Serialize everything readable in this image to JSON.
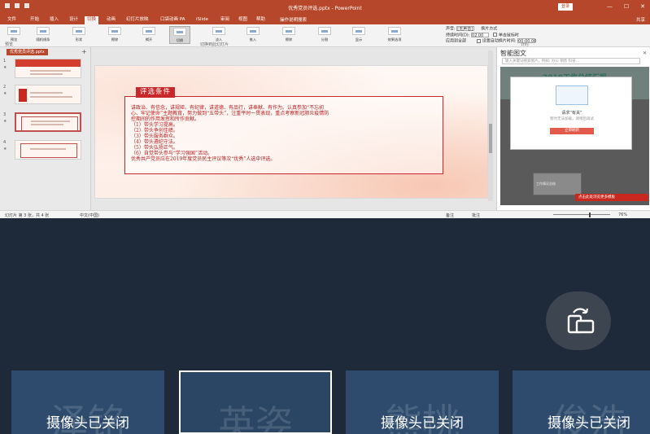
{
  "ppt": {
    "title": "优秀党员评选.pptx - PowerPoint",
    "account": "登录",
    "tabs": [
      "文件",
      "开始",
      "插入",
      "设计",
      "切换",
      "动画",
      "幻灯片放映",
      "口袋动画 PA",
      "iSlide",
      "审阅",
      "视图",
      "帮助",
      "PDF"
    ],
    "active_tab_index": 4,
    "tell_me": "操作说明搜索",
    "share": "共享",
    "ribbon_buttons": [
      "预览",
      "随机线条",
      "形状",
      "擦除",
      "揭开",
      "切换",
      "淡入",
      "推入",
      "擦除",
      "分割",
      "显示",
      "效果选项"
    ],
    "selected_ribbon_index": 4,
    "group_left": "预览",
    "group_mid": "切换到此幻灯片",
    "group_right": "计时",
    "timing": {
      "sound_label": "声音:",
      "sound_value": "[无声音]",
      "duration_label": "持续时间(D):",
      "duration_value": "02.00",
      "apply_all": "应用到全部",
      "advance_label": "换片方式",
      "on_click": "单击鼠标时",
      "after_label": "设置自动换片时间:",
      "after_value": "00:00.00"
    },
    "doc_chip": "优秀党员评选.pptx",
    "thumbs": [
      {
        "num": "1"
      },
      {
        "num": "2"
      },
      {
        "num": "3"
      },
      {
        "num": "4"
      }
    ],
    "selected_thumb_index": 2,
    "slide": {
      "tag": "评选条件",
      "lines": [
        "讲政治、有信念，讲规矩、有纪律，讲道德、有品行，讲奉献、有作为。认真参加“不忘初",
        "心、牢记使命”主题教育，努力做到“五带头”，注重平时一贯表现，重点考察新冠肺炎疫情防",
        "控期间的作用发挥和所作贡献。",
        "（1）带头学习提高。",
        "（2）带头争创佳绩。",
        "（3）带头服务群众。",
        "（4）带头遵纪守法。",
        "（5）带头弘扬正气。",
        "（6）自觉带头参与“学习强国”活动。",
        "      优秀共产党员应在2019年度党员民主评议等次“优秀”人选中评选。"
      ]
    },
    "ai_pane": {
      "title": "智能图文",
      "search_placeholder": "输入关键词搜索图片，例如: 办公 销售 科技...",
      "preview_title": "2019工作总结汇报",
      "modal_title": "请求“有关”",
      "modal_sub": "暂时无法加载，请稍后再试",
      "modal_button": "立即刷新",
      "card_text": "工作情况总结",
      "banner": "点击此处浏览更多模板"
    },
    "status": {
      "slide_info": "幻灯片 第 3 张，共 4 张",
      "language": "中文(中国)",
      "notes": "备注",
      "comments": "批注",
      "zoom": "76%"
    }
  },
  "participants": [
    {
      "bg_name": "泽铭",
      "status": "摄像头已关闭",
      "selected": false
    },
    {
      "bg_name": "英姿",
      "status": "",
      "selected": true
    },
    {
      "bg_name": "熊桃",
      "status": "摄像头已关闭",
      "selected": false
    },
    {
      "bg_name": "俊浩",
      "status": "摄像头已关闭",
      "selected": false
    }
  ],
  "switch_button_icon": "switch-screen-icon",
  "colors": {
    "ppt_accent": "#b7472a",
    "slide_red": "#c8282c",
    "background": "#1e2a3a",
    "tile": "#2e4b6e"
  }
}
